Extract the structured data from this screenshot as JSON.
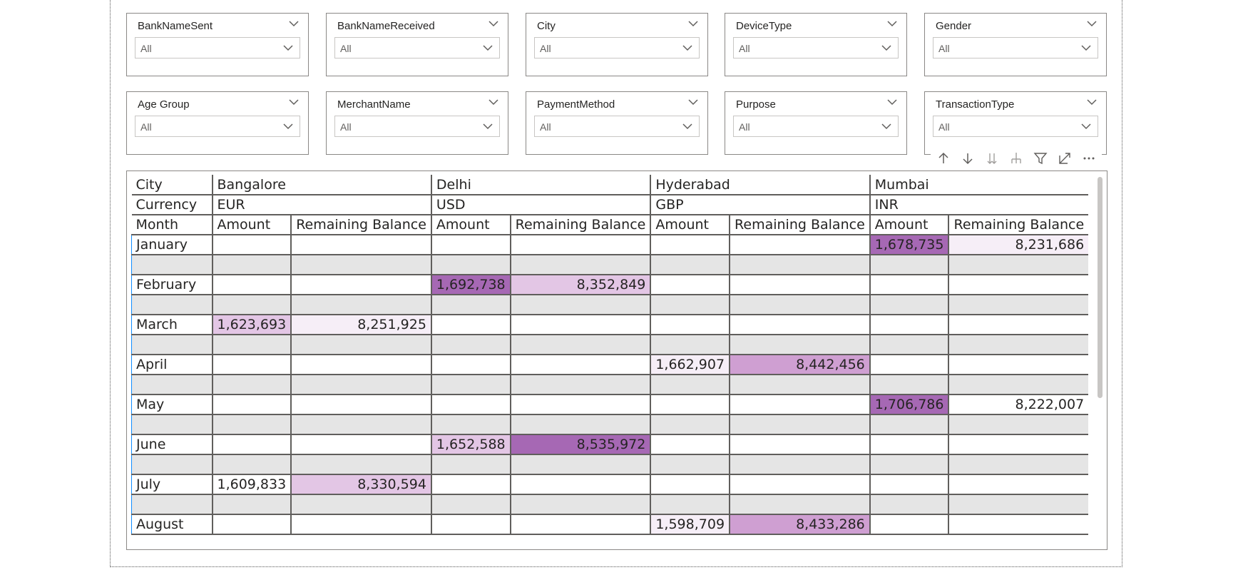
{
  "colors": {
    "accent": "#118dff",
    "shade1": "#f6eef7",
    "shade2": "#e3c6e5",
    "shade3": "#cf9fd2",
    "shade4": "#a668b4",
    "border": "#605e5c"
  },
  "slicers": [
    {
      "title": "BankNameSent",
      "value": "All"
    },
    {
      "title": "BankNameReceived",
      "value": "All"
    },
    {
      "title": "City",
      "value": "All"
    },
    {
      "title": "DeviceType",
      "value": "All"
    },
    {
      "title": "Gender",
      "value": "All"
    },
    {
      "title": "Age Group",
      "value": "All"
    },
    {
      "title": "MerchantName",
      "value": "All"
    },
    {
      "title": "PaymentMethod",
      "value": "All"
    },
    {
      "title": "Purpose",
      "value": "All"
    },
    {
      "title": "TransactionType",
      "value": "All"
    }
  ],
  "toolbar": [
    "arrow-up-icon",
    "arrow-down-icon",
    "double-arrow-down-icon",
    "expand-hierarchy-icon",
    "filter-icon",
    "focus-mode-icon",
    "more-options-icon"
  ],
  "matrix": {
    "row_city_label": "City",
    "row_currency_label": "Currency",
    "row_month_label": "Month",
    "cities": [
      {
        "name": "Bangalore",
        "currency": "EUR"
      },
      {
        "name": "Delhi",
        "currency": "USD"
      },
      {
        "name": "Hyderabad",
        "currency": "GBP"
      },
      {
        "name": "Mumbai",
        "currency": "INR"
      }
    ],
    "measure_amount": "Amount",
    "measure_balance": "Remaining Balance",
    "rows": [
      {
        "month": "January",
        "cells": [
          "",
          "",
          "",
          "",
          "",
          "",
          "1,678,735",
          "8,231,686"
        ]
      },
      {
        "month": "February",
        "cells": [
          "",
          "",
          "1,692,738",
          "8,352,849",
          "",
          "",
          "",
          ""
        ]
      },
      {
        "month": "March",
        "cells": [
          "1,623,693",
          "8,251,925",
          "",
          "",
          "",
          "",
          "",
          ""
        ]
      },
      {
        "month": "April",
        "cells": [
          "",
          "",
          "",
          "",
          "1,662,907",
          "8,442,456",
          "",
          ""
        ]
      },
      {
        "month": "May",
        "cells": [
          "",
          "",
          "",
          "",
          "",
          "",
          "1,706,786",
          "8,222,007"
        ]
      },
      {
        "month": "June",
        "cells": [
          "",
          "",
          "1,652,588",
          "8,535,972",
          "",
          "",
          "",
          ""
        ]
      },
      {
        "month": "July",
        "cells": [
          "1,609,833",
          "8,330,594",
          "",
          "",
          "",
          "",
          "",
          ""
        ]
      },
      {
        "month": "August",
        "cells": [
          "",
          "",
          "",
          "",
          "1,598,709",
          "8,433,286",
          "",
          ""
        ]
      }
    ]
  }
}
